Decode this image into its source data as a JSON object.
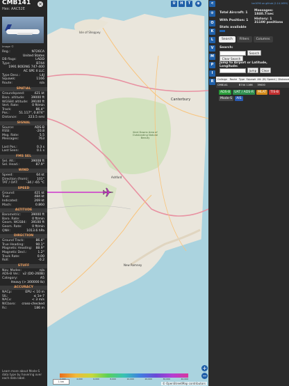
{
  "aircraft": {
    "callsign": "CMB141",
    "hex_line": "Hex: AAC52E",
    "photo_credit": "Image ©"
  },
  "details": [
    {
      "label": "Reg.:",
      "value": "N726CA"
    },
    {
      "label": "",
      "value": "United States"
    },
    {
      "label": "DB flags:",
      "value": "LADD"
    },
    {
      "label": "Type:",
      "value": "B744"
    },
    {
      "label": "",
      "value": "1991 BOEING 747-400"
    },
    {
      "label": "",
      "value": "AC SPE II LLC"
    },
    {
      "label": "Type Desc.:",
      "value": "L4J"
    },
    {
      "label": "Squawk:",
      "value": "1166"
    },
    {
      "label": "Route:",
      "value": "n/a"
    }
  ],
  "sections": [
    {
      "title": "SPATIAL",
      "rows": [
        {
          "label": "Groundspeed:",
          "value": "421 kt"
        },
        {
          "label": "Baro. altitude:",
          "value": "39000 ft"
        },
        {
          "label": "WGS84 altitude:",
          "value": "39100 ft"
        },
        {
          "label": "Vert. Rate:",
          "value": "0 ft/min"
        },
        {
          "label": "Track:",
          "value": "86.4°"
        },
        {
          "label": "Pos.:",
          "value": "51.117°, 0.874°"
        },
        {
          "label": "Distance:",
          "value": "223.5 nmi"
        }
      ]
    },
    {
      "title": "SIGNAL",
      "rows": [
        {
          "label": "Source:",
          "value": "ADS-B"
        },
        {
          "label": "RSSI:",
          "value": "-20.8"
        },
        {
          "label": "Msg. Rate:",
          "value": "5.5"
        },
        {
          "label": "Messages:",
          "value": "763"
        },
        {
          "label": "",
          "value": ""
        },
        {
          "label": "Last Pos.:",
          "value": "0.3 s"
        },
        {
          "label": "Last Seen:",
          "value": "0.1 s"
        }
      ]
    },
    {
      "title": "FMS SEL",
      "rows": [
        {
          "label": "Sel. Alt.:",
          "value": "39008 ft"
        },
        {
          "label": "Sel. Head.:",
          "value": "87.9°"
        }
      ]
    },
    {
      "title": "WIND",
      "rows": [
        {
          "label": "Speed:",
          "value": "64 kt"
        },
        {
          "label": "Direction (from):",
          "value": "101°"
        },
        {
          "label": "TAT / OAT:",
          "value": "-34 / -65 °C"
        }
      ]
    },
    {
      "title": "SPEED",
      "rows": [
        {
          "label": "Ground:",
          "value": "421 kt"
        },
        {
          "label": "True:",
          "value": "484 kt"
        },
        {
          "label": "Indicated:",
          "value": "269 kt"
        },
        {
          "label": "Mach:",
          "value": "0.860"
        }
      ]
    },
    {
      "title": "ALTITUDE",
      "rows": [
        {
          "label": "Barometric:",
          "value": "39000 ft"
        },
        {
          "label": "Baro. Rate:",
          "value": "0 ft/min"
        },
        {
          "label": "Geom. WGS84:",
          "value": "39100 ft"
        },
        {
          "label": "Geom. Rate:",
          "value": "0 ft/min"
        },
        {
          "label": "QNH:",
          "value": "1013.6 hPa"
        }
      ]
    },
    {
      "title": "DIRECTION",
      "rows": [
        {
          "label": "Ground Track:",
          "value": "86.4°"
        },
        {
          "label": "True Heading:",
          "value": "90.1°"
        },
        {
          "label": "Magnetic Heading:",
          "value": "88.9°"
        },
        {
          "label": "Magnetic Decl.:",
          "value": "1.2°"
        },
        {
          "label": "Track Rate:",
          "value": "0.00"
        },
        {
          "label": "Roll:",
          "value": "-0.2"
        }
      ]
    },
    {
      "title": "STUFF",
      "rows": [
        {
          "label": "Nav. Modes:",
          "value": "n/a"
        },
        {
          "label": "ADS-B Ver.:",
          "value": "v2 (DO-260B)"
        },
        {
          "label": "Category:",
          "value": "A5"
        },
        {
          "label": "",
          "value": "Heavy (> 300000 lb)"
        }
      ]
    },
    {
      "title": "ACCURACY",
      "rows": [
        {
          "label": "NACp:",
          "value": "EPU < 10 m"
        },
        {
          "label": "SIL:",
          "value": "≤ 1e-7"
        },
        {
          "label": "NACv:",
          "value": "< 3 m/s"
        },
        {
          "label": "NICbaro:",
          "value": "cross-checked"
        },
        {
          "label": "Rc:",
          "value": "186 m"
        }
      ]
    }
  ],
  "footer_text": "Learn more about Mode-S data type by hovering over each data label.",
  "map": {
    "top_buttons": [
      "U",
      "H",
      "T"
    ],
    "labels": {
      "isle": "Isle of Sheppey",
      "canterbury": "Canterbury",
      "aonb": "Kent Downs Area of Outstanding Natural Beauty",
      "ashford": "Ashford",
      "new_romney": "New Romney"
    },
    "zoom_in": "+",
    "zoom_out": "−",
    "scale_button": "1 km",
    "alt_scale": [
      "2,000",
      "4,000",
      "6,000",
      "8,000",
      "10,000",
      "20,000",
      "30,000",
      "40,000"
    ],
    "attribution": "© OpenStreetMap contributors"
  },
  "side_buttons": [
    "<",
    "⚙",
    "O",
    "K",
    "L",
    "V",
    "M",
    "P",
    "I",
    "R"
  ],
  "right": {
    "version": "tar1090 on github (2.14.1659)",
    "total_label": "Total Aircraft: 1",
    "messages_label": "Messages:",
    "messages_value": "1840.7/sec",
    "position_label": "With Position: 1",
    "history_label": "History: 1",
    "history_value": "31100 positions",
    "stats_label": "Stats available",
    "tabs": [
      "Search",
      "Filters",
      "Columns"
    ],
    "search_label": "Search:",
    "search_button": "Search",
    "clear_search": "Clear Search",
    "jump_label": "Jump to Airport or Latitude, Longitude:",
    "jump_button": "Jump",
    "clear_button": "Clear",
    "columns": [
      "Callsign",
      "Route",
      "Type",
      "Squawk",
      "Alt. (ft)",
      "Speed (kt)",
      "Distance"
    ],
    "row": [
      "CMB141",
      "",
      "B744",
      "1166",
      "39000",
      "",
      ""
    ],
    "flags": [
      "ADS-B",
      "UAT / ADS-R",
      "MLAT",
      "TIS-B",
      "Mode-S",
      "AIS"
    ]
  },
  "colors": {
    "accent": "#1f5fa8",
    "section_title": "#f0a060",
    "track": "#cc33cc",
    "flag_adsb": "#2a9d3a",
    "flag_uat": "#2f8f4e",
    "flag_mlat": "#d48a1a",
    "flag_tisb": "#c22f2f",
    "flag_modes": "#4a4a4a",
    "flag_ais": "#2a5ab0"
  }
}
